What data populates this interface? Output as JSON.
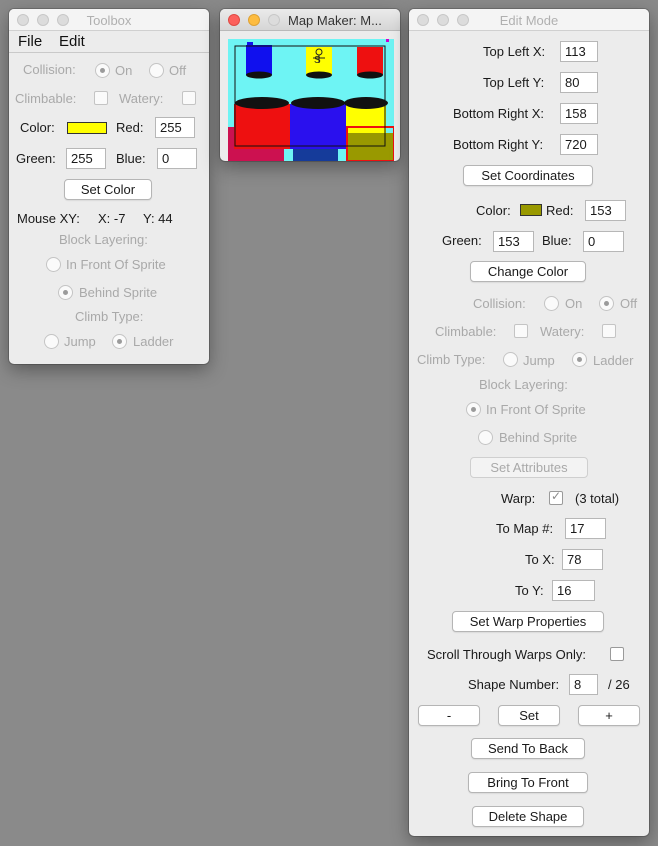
{
  "toolbox": {
    "title": "Toolbox",
    "menu": [
      "File",
      "Edit"
    ],
    "collision_label": "Collision:",
    "collision_on": "On",
    "collision_off": "Off",
    "climbable_label": "Climbable:",
    "watery_label": "Watery:",
    "color_label": "Color:",
    "color_hex": "#ffff00",
    "red_label": "Red:",
    "red_value": "255",
    "green_label": "Green:",
    "green_value": "255",
    "blue_label": "Blue:",
    "blue_value": "0",
    "set_color": "Set Color",
    "mouse_label": "Mouse XY:",
    "mouse_x": "X: -7",
    "mouse_y": "Y: 44",
    "block_layering": "Block Layering:",
    "in_front": "In Front Of Sprite",
    "behind": "Behind Sprite",
    "climb_type": "Climb Type:",
    "jump": "Jump",
    "ladder": "Ladder"
  },
  "mapmaker": {
    "title": "Map Maker: M..."
  },
  "edit": {
    "title": "Edit Mode",
    "top_left_x_label": "Top Left X:",
    "top_left_x": "113",
    "top_left_y_label": "Top Left Y:",
    "top_left_y": "80",
    "bottom_right_x_label": "Bottom Right X:",
    "bottom_right_x": "158",
    "bottom_right_y_label": "Bottom Right Y:",
    "bottom_right_y": "720",
    "set_coordinates": "Set Coordinates",
    "color_label": "Color:",
    "color_hex": "#999900",
    "red_label": "Red:",
    "red_value": "153",
    "green_label": "Green:",
    "green_value": "153",
    "blue_label": "Blue:",
    "blue_value": "0",
    "change_color": "Change Color",
    "collision_label": "Collision:",
    "collision_on": "On",
    "collision_off": "Off",
    "climbable_label": "Climbable:",
    "watery_label": "Watery:",
    "climb_type_label": "Climb Type:",
    "jump": "Jump",
    "ladder": "Ladder",
    "block_layering": "Block Layering:",
    "in_front": "In Front Of Sprite",
    "behind": "Behind Sprite",
    "set_attributes": "Set Attributes",
    "warp_label": "Warp:",
    "warp_total": "(3 total)",
    "to_map_label": "To Map #:",
    "to_map": "17",
    "to_x_label": "To X:",
    "to_x": "78",
    "to_y_label": "To Y:",
    "to_y": "16",
    "set_warp": "Set Warp Properties",
    "scroll_warps": "Scroll Through Warps Only:",
    "shape_number_label": "Shape Number:",
    "shape_number": "8",
    "shape_total": "/ 26",
    "minus": "-",
    "set": "Set",
    "plus": "+",
    "send_back": "Send To Back",
    "bring_front": "Bring To Front",
    "delete_shape": "Delete Shape"
  }
}
